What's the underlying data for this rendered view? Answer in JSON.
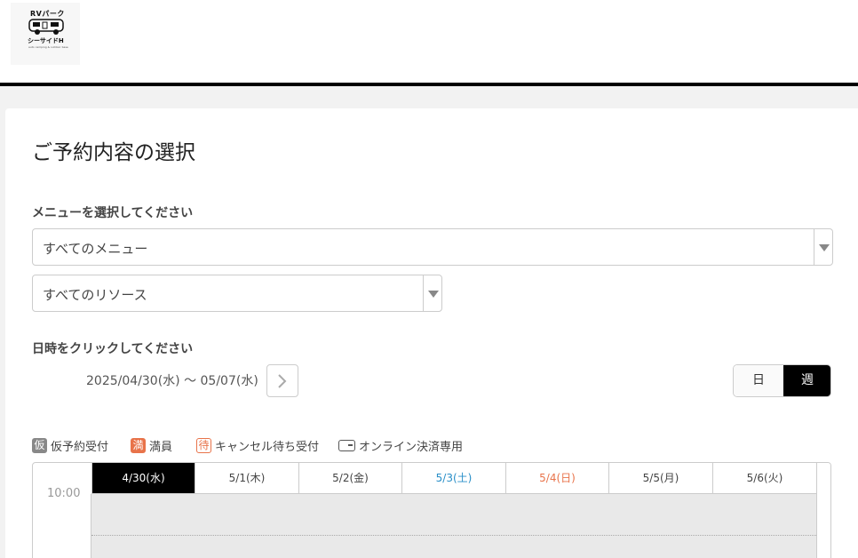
{
  "logo": {
    "top": "RVパーク",
    "bottom": "シーサイドH",
    "small": "auto camping & outdoor base"
  },
  "page_title": "ご予約内容の選択",
  "menu_label": "メニューを選択してください",
  "menu_select": "すべてのメニュー",
  "resource_select": "すべてのリソース",
  "datetime_label": "日時をクリックしてください",
  "date_range": "2025/04/30(水) 〜 05/07(水)",
  "view_toggle": {
    "day": "日",
    "week": "週"
  },
  "legend": [
    {
      "badge": "仮",
      "text": "仮予約受付"
    },
    {
      "badge": "満",
      "text": "満員"
    },
    {
      "badge": "待",
      "text": "キャンセル待ち受付"
    },
    {
      "text": "オンライン決済専用"
    }
  ],
  "calendar": {
    "days": [
      "4/30(水)",
      "5/1(木)",
      "5/2(金)",
      "5/3(土)",
      "5/4(日)",
      "5/5(月)",
      "5/6(火)"
    ],
    "first_time": "10:00"
  },
  "colors": {
    "accent": "#000000",
    "saturday": "#2a8fc8",
    "sunday": "#e8734a",
    "badge_gray": "#888888",
    "badge_red": "#e8734a"
  }
}
